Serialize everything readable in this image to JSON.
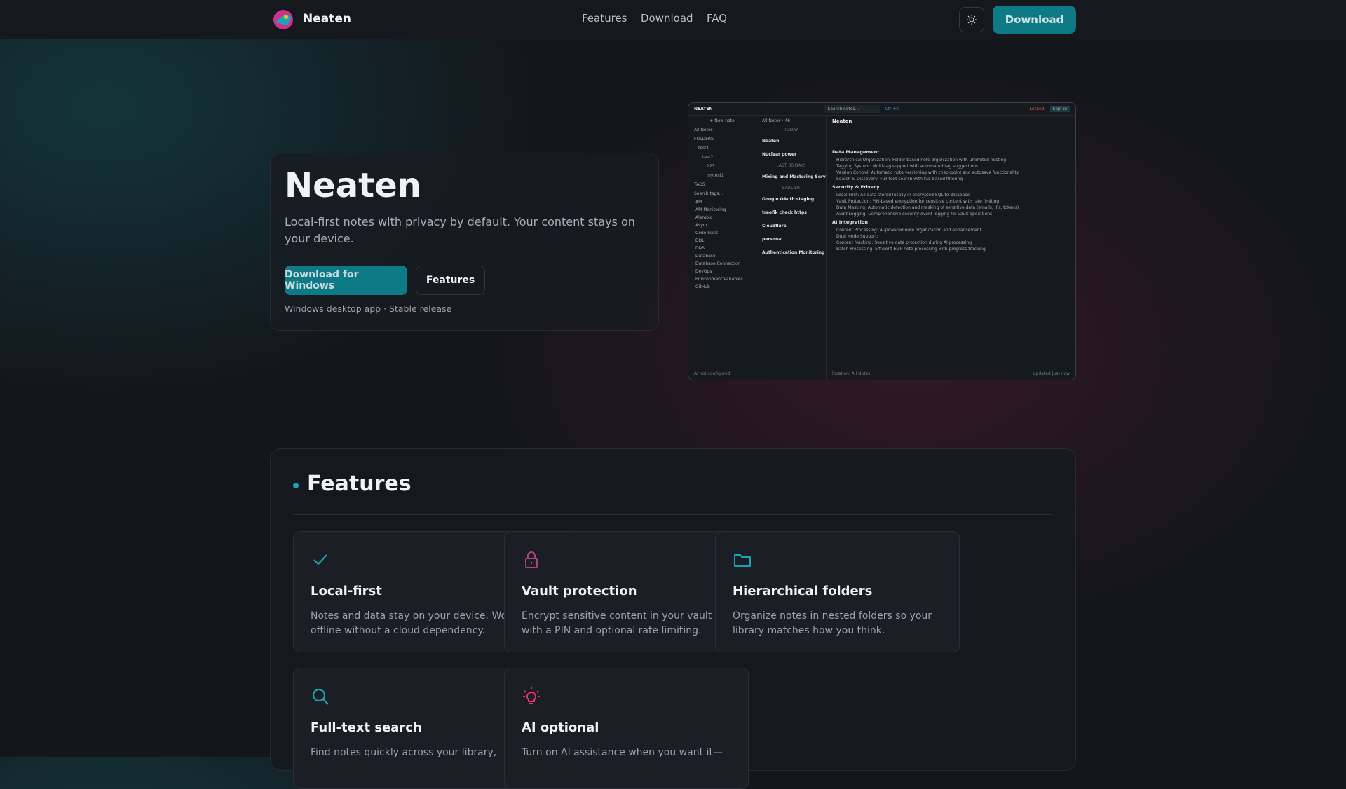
{
  "header": {
    "brand": "Neaten",
    "nav": [
      "Features",
      "Download",
      "FAQ"
    ],
    "theme_icon": "sun-icon",
    "download_label": "Download"
  },
  "hero": {
    "title": "Neaten",
    "subtitle": "Local-first notes with privacy by default. Your content stays on your device.",
    "primary_button": "Download for Windows",
    "secondary_button": "Features",
    "caption": "Windows desktop app · Stable release"
  },
  "app_preview": {
    "app_name": "NEATEN",
    "search": "Search notes...",
    "shortcut": "Ctrl+K",
    "locked": "Locked",
    "sign_in": "Sign in",
    "new_note": "+ New note",
    "all_notes": "All Notes",
    "folders_label": "FOLDERS",
    "folders": [
      "test1",
      "test2",
      "123",
      "mytest1"
    ],
    "tags_label": "TAGS",
    "search_tags": "Search tags...",
    "all_tags": [
      "API",
      "API Monitoring",
      "Alembic",
      "Async",
      "Code Fixes",
      "DDL",
      "DNS",
      "Database",
      "Database Connection",
      "DevOps",
      "Environment Variables",
      "GitHub"
    ],
    "list_header": "All Notes · 46",
    "groups": [
      "TODAY",
      "LAST 30 DAYS",
      "EARLIER"
    ],
    "notes": [
      "Neaten",
      "Nuclear power",
      "Mixing and Mastering Servi...",
      "Google OAuth staging",
      "traefik check https",
      "Cloudflare",
      "personal",
      "Authentication Monitoring Mo..."
    ],
    "editor_title": "Neaten",
    "sections": [
      {
        "h": "Data Management",
        "items": [
          "Hierarchical Organization: Folder-based note organization with unlimited nesting",
          "Tagging System: Multi-tag support with automated tag suggestions",
          "Version Control: Automatic note versioning with checkpoint and autosave functionality",
          "Search & Discovery: Full-text search with tag-based filtering"
        ]
      },
      {
        "h": "Security & Privacy",
        "items": [
          "Local-First: All data stored locally in encrypted SQLite database",
          "Vault Protection: PIN-based encryption for sensitive content with rate limiting",
          "Data Masking: Automatic detection and masking of sensitive data (emails, IPs, tokens)",
          "Audit Logging: Comprehensive security event logging for vault operations"
        ]
      },
      {
        "h": "AI Integration",
        "items": [
          "Content Processing: AI-powered note organization and enhancement",
          "Dual Mode Support:",
          "Content Masking: Sensitive data protection during AI processing",
          "Batch Processing: Efficient bulk note processing with progress tracking"
        ]
      }
    ],
    "status_left": "location: All Notes",
    "status_right": "Updated Just now",
    "ai_status": "AI not configured"
  },
  "features": {
    "title": "Features",
    "cards": [
      {
        "icon": "check-icon",
        "title": "Local-first",
        "desc": "Notes and data stay on your device. Work offline without a cloud dependency.",
        "color": "#19a3b3"
      },
      {
        "icon": "lock-icon",
        "title": "Vault protection",
        "desc": "Encrypt sensitive content in your vault with a PIN and optional rate limiting.",
        "color": "#b0417f"
      },
      {
        "icon": "folder-icon",
        "title": "Hierarchical folders",
        "desc": "Organize notes in nested folders so your library matches how you think.",
        "color": "#19a3b3"
      },
      {
        "icon": "search-icon",
        "title": "Full-text search",
        "desc": "Find notes quickly across your library,",
        "color": "#19a3b3"
      },
      {
        "icon": "lightbulb-icon",
        "title": "AI optional",
        "desc": "Turn on AI assistance when you want it—",
        "color": "#e8336f"
      }
    ]
  }
}
